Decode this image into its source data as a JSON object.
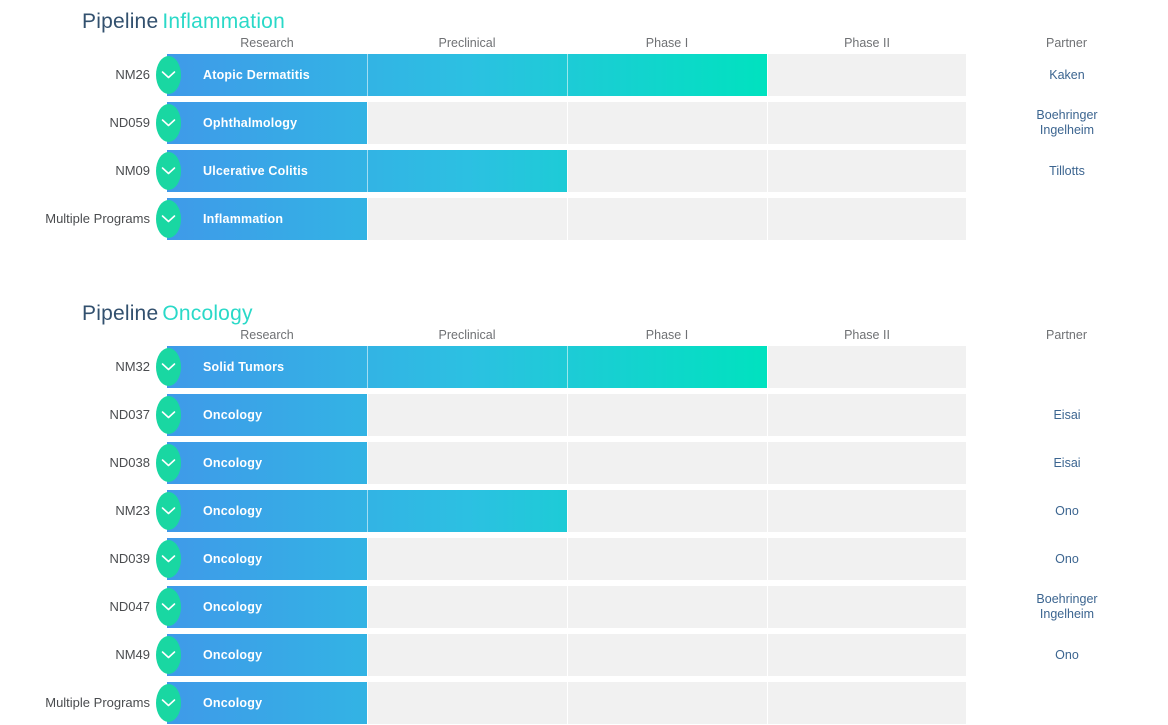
{
  "sections": [
    {
      "title_main": "Pipeline",
      "title_accent": "Inflammation",
      "columns": [
        "Research",
        "Preclinical",
        "Phase I",
        "Phase II",
        "Partner"
      ],
      "rows": [
        {
          "code": "NM26",
          "program": "Atopic Dermatitis",
          "stages": 3,
          "partner": "Kaken",
          "icon": "chevron-down-icon"
        },
        {
          "code": "ND059",
          "program": "Ophthalmology",
          "stages": 1,
          "partner": "Boehringer\nIngelheim",
          "icon": "chevron-down-icon"
        },
        {
          "code": "NM09",
          "program": "Ulcerative Colitis",
          "stages": 2,
          "partner": "Tillotts",
          "icon": "chevron-down-icon"
        },
        {
          "code": "Multiple Programs",
          "program": "Inflammation",
          "stages": 1,
          "partner": "",
          "icon": "chevron-down-icon"
        }
      ]
    },
    {
      "title_main": "Pipeline",
      "title_accent": "Oncology",
      "columns": [
        "Research",
        "Preclinical",
        "Phase I",
        "Phase II",
        "Partner"
      ],
      "rows": [
        {
          "code": "NM32",
          "program": "Solid Tumors",
          "stages": 3,
          "partner": "",
          "icon": "chevron-down-icon"
        },
        {
          "code": "ND037",
          "program": "Oncology",
          "stages": 1,
          "partner": "Eisai",
          "icon": "chevron-down-icon"
        },
        {
          "code": "ND038",
          "program": "Oncology",
          "stages": 1,
          "partner": "Eisai",
          "icon": "chevron-down-icon"
        },
        {
          "code": "NM23",
          "program": "Oncology",
          "stages": 2,
          "partner": "Ono",
          "icon": "chevron-down-icon"
        },
        {
          "code": "ND039",
          "program": "Oncology",
          "stages": 1,
          "partner": "Ono",
          "icon": "chevron-down-icon"
        },
        {
          "code": "ND047",
          "program": "Oncology",
          "stages": 1,
          "partner": "Boehringer\nIngelheim",
          "icon": "chevron-down-icon"
        },
        {
          "code": "NM49",
          "program": "Oncology",
          "stages": 1,
          "partner": "Ono",
          "icon": "chevron-down-icon"
        },
        {
          "code": "Multiple Programs",
          "program": "Oncology",
          "stages": 1,
          "partner": "",
          "icon": "chevron-down-icon"
        }
      ]
    }
  ],
  "colors": {
    "title_main": "#32506e",
    "title_accent": "#2ad9c8",
    "bar_start": "#3f9ae9",
    "bar_mid": "#2cc0e2",
    "bar_end": "#00e2bf",
    "track": "#f1f1f1",
    "expand_circle": "#19d7a2",
    "partner_text": "#3c6590",
    "column_header": "#6f7174",
    "row_code": "#4a4c4f"
  }
}
